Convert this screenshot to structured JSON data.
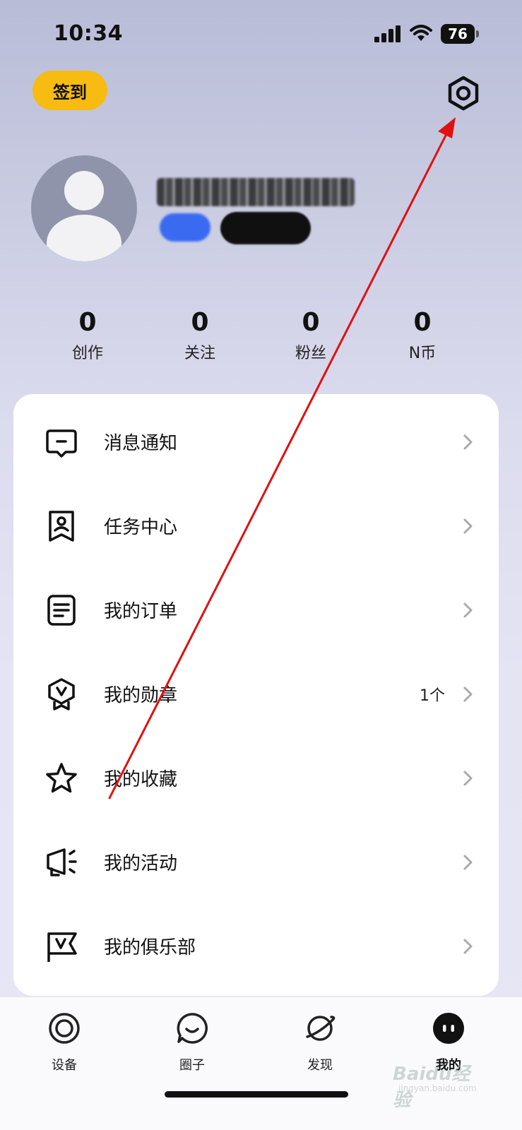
{
  "status_bar": {
    "time": "10:34",
    "battery": "76"
  },
  "header": {
    "checkin_label": "签到",
    "settings_icon": "gear-icon"
  },
  "stats": [
    {
      "value": "0",
      "label": "创作"
    },
    {
      "value": "0",
      "label": "关注"
    },
    {
      "value": "0",
      "label": "粉丝"
    },
    {
      "value": "0",
      "label": "N币"
    }
  ],
  "menu": [
    {
      "label": "消息通知",
      "value": "",
      "icon": "message-icon"
    },
    {
      "label": "任务中心",
      "value": "",
      "icon": "task-badge-icon"
    },
    {
      "label": "我的订单",
      "value": "",
      "icon": "order-document-icon"
    },
    {
      "label": "我的勋章",
      "value": "1个",
      "icon": "medal-icon"
    },
    {
      "label": "我的收藏",
      "value": "",
      "icon": "star-icon"
    },
    {
      "label": "我的活动",
      "value": "",
      "icon": "megaphone-icon"
    },
    {
      "label": "我的俱乐部",
      "value": "",
      "icon": "club-flag-icon"
    }
  ],
  "tabs": [
    {
      "label": "设备",
      "icon": "device-ring-icon",
      "active": false
    },
    {
      "label": "圈子",
      "icon": "chat-smile-icon",
      "active": false
    },
    {
      "label": "发现",
      "icon": "planet-icon",
      "active": false
    },
    {
      "label": "我的",
      "icon": "profile-face-icon",
      "active": true
    }
  ],
  "colors": {
    "accent": "#f7bb12",
    "annotation": "#e01010",
    "background": "#e4e4f3"
  },
  "watermark": {
    "main": "Baidu经验",
    "sub": "jingyan.baidu.com"
  }
}
